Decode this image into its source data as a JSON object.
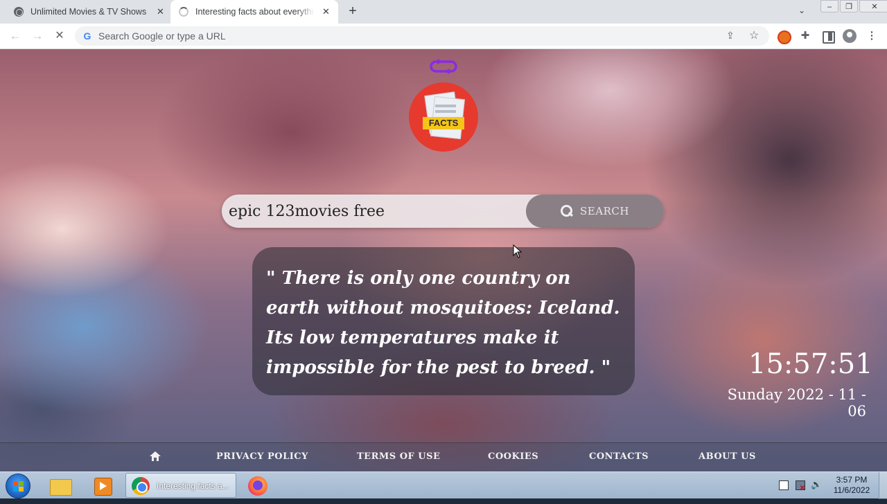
{
  "browser": {
    "tabs": [
      {
        "title": "Unlimited Movies & TV Shows",
        "active": false
      },
      {
        "title": "Interesting facts about everything",
        "active": true
      }
    ],
    "omnibox_placeholder": "Search Google or type a URL"
  },
  "page": {
    "logo_badge": "FACTS",
    "search": {
      "value": "epic 123movies free",
      "button_label": "SEARCH"
    },
    "fact": "\"  There is only one country on earth without mosquitoes: Iceland. Its low temperatures make it impossible for the pest to breed.  \"",
    "clock": "15:57:51",
    "date": "Sunday 2022 - 11 - 06",
    "footer": {
      "privacy": "PRIVACY POLICY",
      "terms": "TERMS OF USE",
      "cookies": "COOKIES",
      "contacts": "CONTACTS",
      "about": "ABOUT US"
    }
  },
  "taskbar": {
    "chrome_label": "Interesting facts a...",
    "time": "3:57 PM",
    "date": "11/6/2022"
  },
  "colors": {
    "logo_red": "#e63a2e",
    "badge_yellow": "#f5c518",
    "sync_purple": "#8a2be2"
  }
}
